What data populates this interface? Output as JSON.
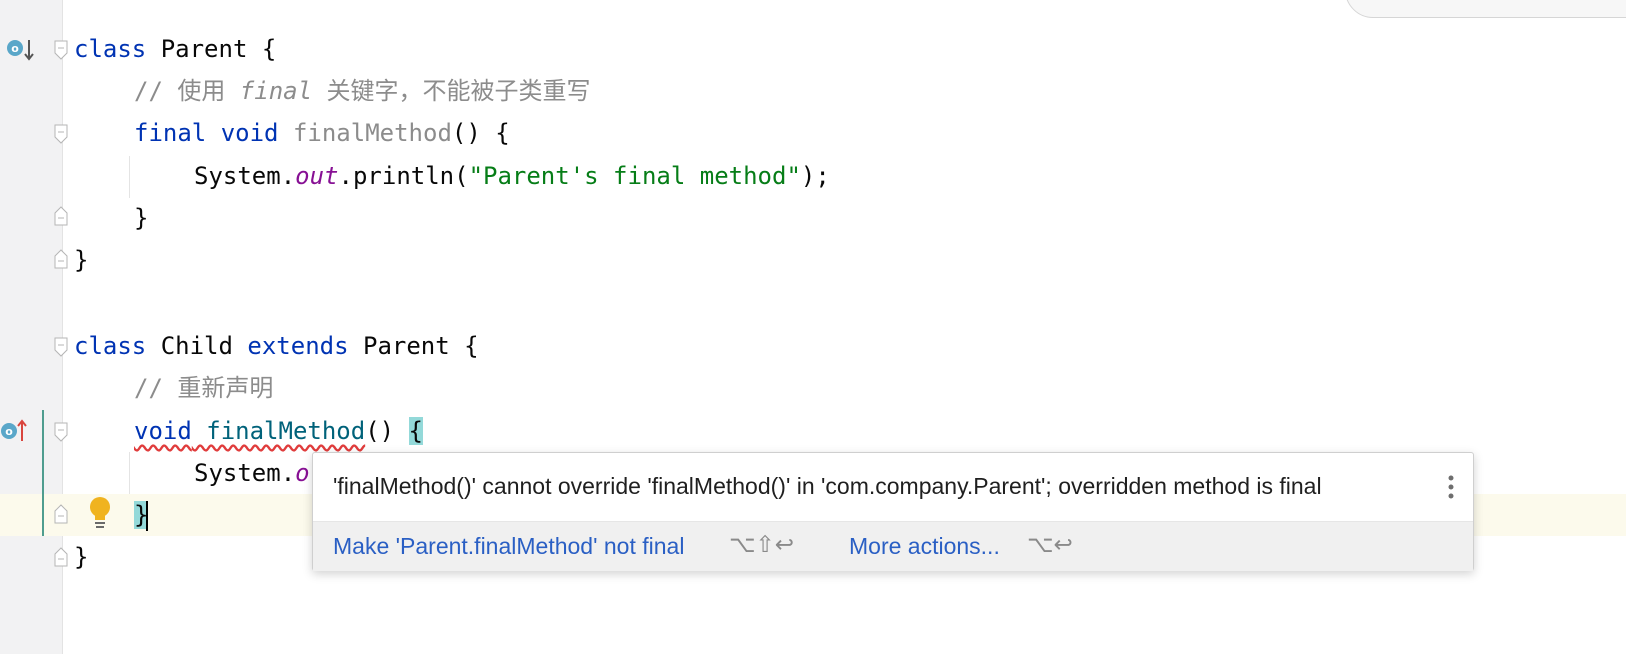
{
  "editor": {
    "lines": {
      "l1": {
        "kw_class": "class",
        "name": " Parent {"
      },
      "l2": {
        "prefix": "// 使用 ",
        "italic": "final",
        "suffix": " 关键字，不能被子类重写"
      },
      "l3": {
        "kw_final": "final",
        "kw_void": " void",
        "method": " finalMethod",
        "rest": "() {"
      },
      "l4": {
        "sys": "System.",
        "out": "out",
        "call": ".println(",
        "str": "\"Parent's final method\"",
        "end": ");"
      },
      "l5": {
        "text": "}"
      },
      "l6": {
        "text": "}"
      },
      "l8": {
        "kw_class": "class",
        "name": " Child ",
        "kw_extends": "extends",
        "parent": " Parent {"
      },
      "l9": {
        "comment": "// 重新声明"
      },
      "l10": {
        "kw_void": "void",
        "method": " finalMethod",
        "paren": "() ",
        "brace": "{"
      },
      "l11": {
        "sys": "System.",
        "out_partial": "o"
      },
      "l12": {
        "brace": "}"
      },
      "l13": {
        "text": "}"
      }
    },
    "gutter_icons": {
      "overridden": "overridden-method-down-arrow-icon",
      "overriding": "overriding-method-up-arrow-icon",
      "bulb": "lightbulb-icon"
    }
  },
  "popup": {
    "message": "'finalMethod()' cannot override 'finalMethod()' in 'com.company.Parent'; overridden method is final",
    "action_primary": "Make 'Parent.finalMethod' not final",
    "action_primary_shortcut": "⌥⇧↩",
    "action_more": "More actions...",
    "action_more_shortcut": "⌥↩",
    "more_icon": "vertical-ellipsis-icon"
  },
  "colors": {
    "keyword": "#0033b3",
    "comment": "#8c8c8c",
    "string": "#067d17",
    "field": "#871094",
    "method_decl": "#00627a",
    "link": "#2a5fc4",
    "error_underline": "#e03c3c"
  }
}
